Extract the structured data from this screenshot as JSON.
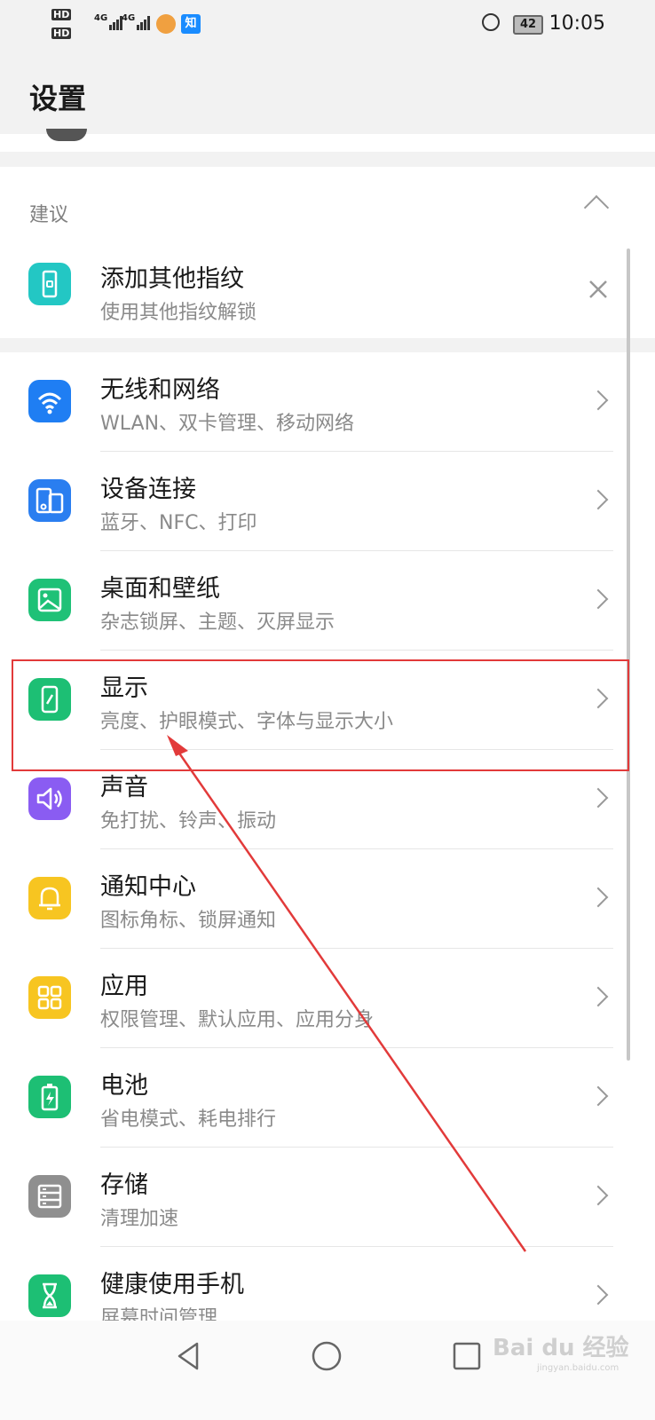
{
  "status_bar": {
    "left_indicators": [
      "HD",
      "HD"
    ],
    "network_1": "4G",
    "network_2": "4G",
    "zhihu_badge": "知",
    "battery": "42",
    "time": "10:05"
  },
  "header": {
    "title": "设置"
  },
  "suggestions": {
    "section_label": "建议",
    "item": {
      "title": "添加其他指纹",
      "subtitle": "使用其他指纹解锁",
      "icon": "fingerprint-phone-icon",
      "color": "#23c7c4"
    }
  },
  "settings": {
    "items": [
      {
        "title": "无线和网络",
        "subtitle": "WLAN、双卡管理、移动网络",
        "icon": "wifi-icon",
        "color": "#1f7ef3"
      },
      {
        "title": "设备连接",
        "subtitle": "蓝牙、NFC、打印",
        "icon": "device-connection-icon",
        "color": "#2a7ef0"
      },
      {
        "title": "桌面和壁纸",
        "subtitle": "杂志锁屏、主题、灭屏显示",
        "icon": "wallpaper-icon",
        "color": "#1fc177"
      },
      {
        "title": "显示",
        "subtitle": "亮度、护眼模式、字体与显示大小",
        "icon": "display-icon",
        "color": "#1dbf74"
      },
      {
        "title": "声音",
        "subtitle": "免打扰、铃声、振动",
        "icon": "speaker-icon",
        "color": "#8a5cf2"
      },
      {
        "title": "通知中心",
        "subtitle": "图标角标、锁屏通知",
        "icon": "bell-icon",
        "color": "#f7c521"
      },
      {
        "title": "应用",
        "subtitle": "权限管理、默认应用、应用分身",
        "icon": "apps-grid-icon",
        "color": "#f7c521"
      },
      {
        "title": "电池",
        "subtitle": "省电模式、耗电排行",
        "icon": "battery-icon",
        "color": "#1dbf74"
      },
      {
        "title": "存储",
        "subtitle": "清理加速",
        "icon": "storage-icon",
        "color": "#8f8f8f"
      },
      {
        "title": "健康使用手机",
        "subtitle": "屏幕时间管理",
        "icon": "hourglass-icon",
        "color": "#1dbf74"
      }
    ]
  },
  "annotation": {
    "highlight_color": "#e23a3a",
    "target": "显示"
  },
  "watermark": {
    "brand": "Bai du 经验",
    "url": "jingyan.baidu.com"
  }
}
